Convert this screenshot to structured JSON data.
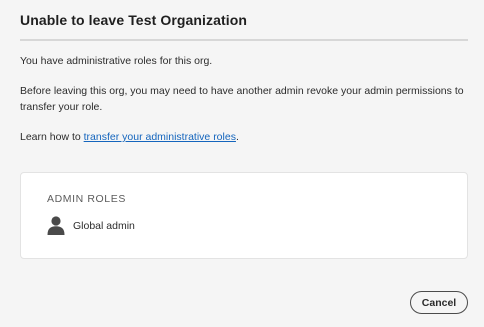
{
  "dialog": {
    "title": "Unable to leave Test Organization",
    "paragraph_1": "You have administrative roles for this org.",
    "paragraph_2": "Before leaving this org, you may need to have another admin revoke your admin permissions to transfer your role.",
    "paragraph_3_prefix": "Learn how to ",
    "paragraph_3_link": "transfer your administrative roles",
    "paragraph_3_suffix": ".",
    "admin_roles": {
      "heading": "ADMIN ROLES",
      "roles": [
        {
          "icon": "user-icon",
          "label": "Global admin"
        }
      ]
    },
    "cancel_label": "Cancel"
  },
  "colors": {
    "background": "#f5f5f5",
    "link": "#1465bd",
    "card": "#ffffff",
    "divider": "#d7d7d7"
  }
}
